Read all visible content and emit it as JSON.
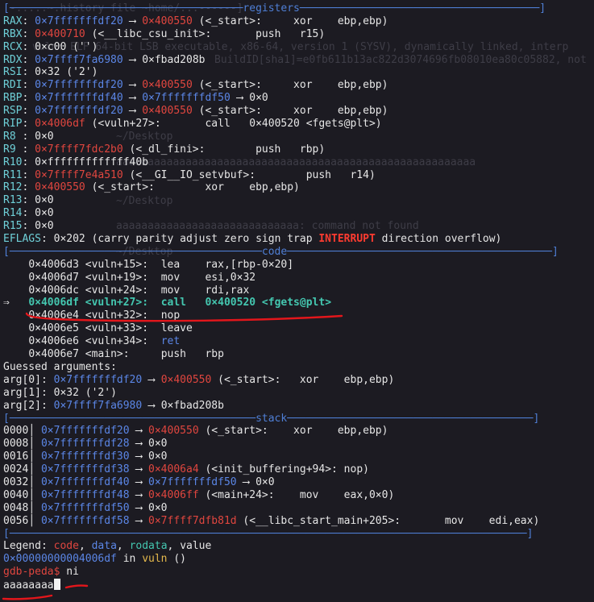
{
  "colors": {
    "background": "#1c1b22",
    "separator": "#4f7fd6",
    "register": "#6fd0d8",
    "stack_addr": "#5b86e6",
    "code_addr": "#e0463f",
    "current_instr": "#44c7b0",
    "annotation_underline": "#e3161b"
  },
  "ghost_text": [
    "[-.....~.history file ~home/...------]",
    "vuln: ELF 64-bit LSB executable, x86-64, version 1 (SYSV), dynamically linked, interp",
    "BuildID[sha1]=e0fb611b13ac822d3074696fb08010ea80c05882, not",
    "~/Desktop",
    "aaaaaaaaaaaaaaaaaaaaaaaaaaaaaaaaaaaaaaaaaaaaaaaaaaaaaaaaa",
    "~/Desktop",
    "aaaaaaaaaaaaaaaaaaaaaaaaaaaaa: command not found",
    "~/Desktop"
  ],
  "sections": {
    "registers": "registers",
    "code": "code",
    "stack": "stack"
  },
  "registers": [
    {
      "name": "RAX",
      "val": "0×7fffffffdf20",
      "arrow": " ⟶ ",
      "tgt": "0×400550",
      "rest": " (<_start>:     xor    ebp,ebp)"
    },
    {
      "name": "RBX",
      "val": "0×400710",
      "arrow": "",
      "tgt": "",
      "rest": " (<__libc_csu_init>:       push   r15)"
    },
    {
      "name": "RCX",
      "val": "0×c00",
      "arrow": "",
      "tgt": "",
      "rest": " ('')"
    },
    {
      "name": "RDX",
      "val": "0×7ffff7fa6980",
      "arrow": " ⟶ ",
      "tgt": "0×fbad208b",
      "rest": ""
    },
    {
      "name": "RSI",
      "val": "0×32",
      "arrow": "",
      "tgt": "",
      "rest": " ('2')"
    },
    {
      "name": "RDI",
      "val": "0×7fffffffdf20",
      "arrow": " ⟶ ",
      "tgt": "0×400550",
      "rest": " (<_start>:     xor    ebp,ebp)"
    },
    {
      "name": "RBP",
      "val": "0×7fffffffdf40",
      "arrow": " ⟶ ",
      "tgt": "0×7fffffffdf50",
      "rest": " ⟶ 0×0"
    },
    {
      "name": "RSP",
      "val": "0×7fffffffdf20",
      "arrow": " ⟶ ",
      "tgt": "0×400550",
      "rest": " (<_start>:     xor    ebp,ebp)"
    },
    {
      "name": "RIP",
      "val": "0×4006df",
      "arrow": "",
      "tgt": "",
      "rest": " (<vuln+27>:       call   0×400520 <fgets@plt>)"
    },
    {
      "name": "R8 ",
      "val": "0×0",
      "arrow": "",
      "tgt": "",
      "rest": ""
    },
    {
      "name": "R9 ",
      "val": "0×7ffff7fdc2b0",
      "arrow": "",
      "tgt": "",
      "rest": " (<_dl_fini>:        push   rbp)"
    },
    {
      "name": "R10",
      "val": "0×fffffffffffff40b",
      "arrow": "",
      "tgt": "",
      "rest": ""
    },
    {
      "name": "R11",
      "val": "0×7ffff7e4a510",
      "arrow": "",
      "tgt": "",
      "rest": " (<__GI__IO_setvbuf>:        push   r14)"
    },
    {
      "name": "R12",
      "val": "0×400550",
      "arrow": "",
      "tgt": "",
      "rest": " (<_start>:        xor    ebp,ebp)"
    },
    {
      "name": "R13",
      "val": "0×0",
      "arrow": "",
      "tgt": "",
      "rest": ""
    },
    {
      "name": "R14",
      "val": "0×0",
      "arrow": "",
      "tgt": "",
      "rest": ""
    },
    {
      "name": "R15",
      "val": "0×0",
      "arrow": "",
      "tgt": "",
      "rest": ""
    }
  ],
  "eflags": {
    "label": "EFLAGS",
    "value": "0×202",
    "flags_pre": "(carry parity adjust zero sign trap ",
    "flag_set": "INTERRUPT",
    "flags_post": " direction overflow)"
  },
  "code": [
    {
      "marker": "   ",
      "addr": "0×4006d3",
      "sym": "<vuln+15>: ",
      "op": "lea ",
      "args": "rax,[rbp-0×20]",
      "current": false,
      "opclass": "white"
    },
    {
      "marker": "   ",
      "addr": "0×4006d7",
      "sym": "<vuln+19>: ",
      "op": "mov ",
      "args": "esi,0×32",
      "current": false,
      "opclass": "white"
    },
    {
      "marker": "   ",
      "addr": "0×4006dc",
      "sym": "<vuln+24>: ",
      "op": "mov ",
      "args": "rdi,rax",
      "current": false,
      "opclass": "white"
    },
    {
      "marker": "⇒  ",
      "addr": "0×4006df",
      "sym": "<vuln+27>: ",
      "op": "call",
      "args": "0×400520 <fgets@plt>",
      "current": true,
      "opclass": "green"
    },
    {
      "marker": "   ",
      "addr": "0×4006e4",
      "sym": "<vuln+32>: ",
      "op": "nop ",
      "args": "",
      "current": false,
      "opclass": "white"
    },
    {
      "marker": "   ",
      "addr": "0×4006e5",
      "sym": "<vuln+33>: ",
      "op": "leave",
      "args": "",
      "current": false,
      "opclass": "white"
    },
    {
      "marker": "   ",
      "addr": "0×4006e6",
      "sym": "<vuln+34>: ",
      "op": "ret ",
      "args": "",
      "current": false,
      "opclass": "blue"
    },
    {
      "marker": "   ",
      "addr": "0×4006e7",
      "sym": "<main>:    ",
      "op": "push",
      "args": "rbp",
      "current": false,
      "opclass": "white"
    }
  ],
  "guessed": {
    "header": "Guessed arguments:",
    "args": [
      {
        "label": "arg[0]: ",
        "val": "0×7fffffffdf20",
        "arrow": " ⟶ ",
        "tgt": "0×400550",
        "rest": " (<_start>:   xor    ebp,ebp)"
      },
      {
        "label": "arg[1]: ",
        "val": "0×32",
        "arrow": "",
        "tgt": "",
        "rest": " ('2')"
      },
      {
        "label": "arg[2]: ",
        "val": "0×7ffff7fa6980",
        "arrow": " ⟶ ",
        "tgt": "",
        "rest": "0×fbad208b"
      }
    ]
  },
  "stack": [
    {
      "off": "0000",
      "addr": "0×7fffffffdf20",
      "tgt": "0×400550",
      "tgtclass": "red",
      "rest": " (<_start>:    xor    ebp,ebp)"
    },
    {
      "off": "0008",
      "addr": "0×7fffffffdf28",
      "tgt": "0×0",
      "tgtclass": "white",
      "rest": ""
    },
    {
      "off": "0016",
      "addr": "0×7fffffffdf30",
      "tgt": "0×0",
      "tgtclass": "white",
      "rest": ""
    },
    {
      "off": "0024",
      "addr": "0×7fffffffdf38",
      "tgt": "0×4006a4",
      "tgtclass": "red",
      "rest": " (<init_buffering+94>: nop)"
    },
    {
      "off": "0032",
      "addr": "0×7fffffffdf40",
      "tgt": "0×7fffffffdf50",
      "tgtclass": "blue",
      "rest": " ⟶ 0×0"
    },
    {
      "off": "0040",
      "addr": "0×7fffffffdf48",
      "tgt": "0×4006ff",
      "tgtclass": "red",
      "rest": " (<main+24>:    mov    eax,0×0)"
    },
    {
      "off": "0048",
      "addr": "0×7fffffffdf50",
      "tgt": "0×0",
      "tgtclass": "white",
      "rest": ""
    },
    {
      "off": "0056",
      "addr": "0×7fffffffdf58",
      "tgt": "0×7ffff7dfb81d",
      "tgtclass": "red",
      "rest": " (<__libc_start_main+205>:       mov    edi,eax)"
    }
  ],
  "legend": {
    "label": "Legend: ",
    "code": "code",
    "data": "data",
    "rodata": "rodata",
    "value": "value"
  },
  "location": {
    "addr": "0×00000000004006df",
    "in": " in ",
    "func": "vuln",
    "args": " ()"
  },
  "prompt": {
    "text": "gdb-peda$",
    "command": "ni"
  },
  "input_line": "aaaaaaaa"
}
